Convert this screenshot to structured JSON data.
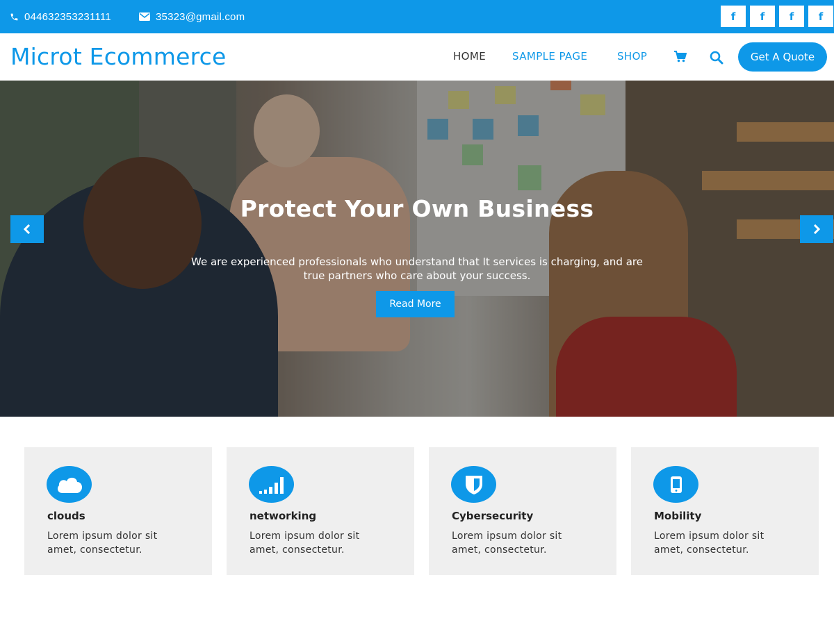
{
  "topbar": {
    "phone": "044632353231111",
    "email": "35323@gmail.com",
    "social": [
      {
        "icon": "facebook-icon",
        "label": "f"
      },
      {
        "icon": "facebook-icon",
        "label": "f"
      },
      {
        "icon": "facebook-icon",
        "label": "f"
      },
      {
        "icon": "facebook-icon",
        "label": "f"
      }
    ]
  },
  "header": {
    "logo": "Microt Ecommerce",
    "nav": [
      "HOME",
      "SAMPLE PAGE",
      "SHOP"
    ],
    "quote_button": "Get A Quote",
    "icons": [
      "cart-icon",
      "search-icon"
    ]
  },
  "hero": {
    "title": "Protect Your Own Business",
    "text": "We are experienced professionals who understand that It services is charging, and are true partners who care about your success.",
    "button": "Read More",
    "prev_label": "‹",
    "next_label": "›"
  },
  "features": [
    {
      "icon": "cloud-icon",
      "title": "clouds",
      "text": "Lorem ipsum dolor sit amet, consectetur."
    },
    {
      "icon": "signal-icon",
      "title": "networking",
      "text": "Lorem ipsum dolor sit amet, consectetur."
    },
    {
      "icon": "shield-icon",
      "title": "Cybersecurity",
      "text": "Lorem ipsum dolor sit amet, consectetur."
    },
    {
      "icon": "mobile-icon",
      "title": "Mobility",
      "text": "Lorem ipsum dolor sit amet, consectetur."
    }
  ],
  "colors": {
    "accent": "#0e98e8",
    "card_bg": "#efefef"
  }
}
